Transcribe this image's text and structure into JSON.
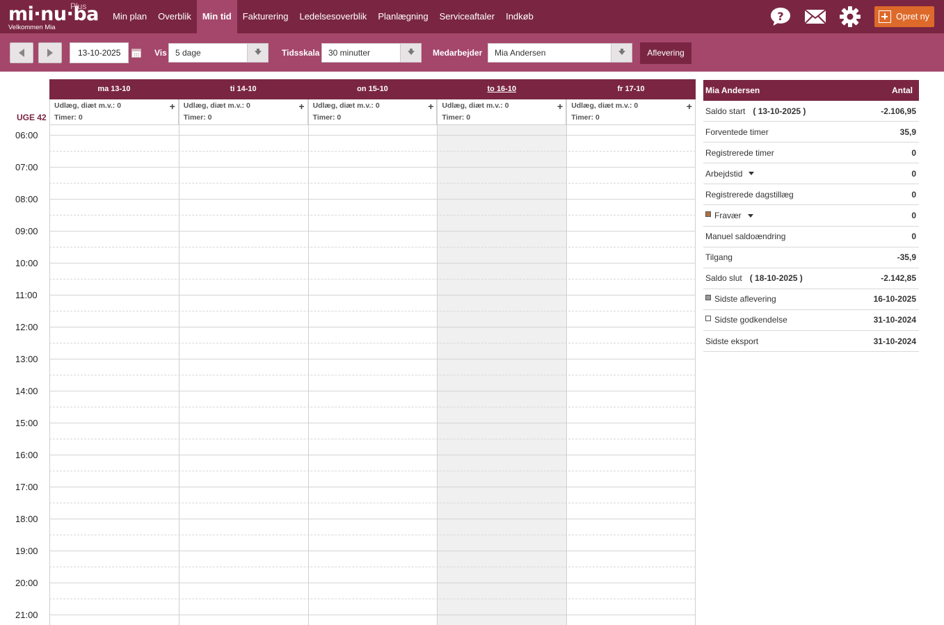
{
  "brand": {
    "logo_text": "mi·nu·ba",
    "plus": "Plus",
    "welcome": "Velkommen  Mia"
  },
  "nav": {
    "items": [
      {
        "label": "Min plan",
        "active": false
      },
      {
        "label": "Overblik",
        "active": false
      },
      {
        "label": "Min tid",
        "active": true
      },
      {
        "label": "Fakturering",
        "active": false
      },
      {
        "label": "Ledelsesoverblik",
        "active": false
      },
      {
        "label": "Planlægning",
        "active": false
      },
      {
        "label": "Serviceaftaler",
        "active": false
      },
      {
        "label": "Indkøb",
        "active": false
      }
    ],
    "icons": [
      "help-icon",
      "mail-icon",
      "gear-icon"
    ],
    "create_label": "Opret ny"
  },
  "toolbar": {
    "date": "13-10-2025",
    "vis_label": "Vis",
    "vis_value": "5 dage",
    "scale_label": "Tidsskala",
    "scale_value": "30 minutter",
    "employee_label": "Medarbejder",
    "employee_value": "Mia Andersen",
    "submit_label": "Aflevering"
  },
  "calendar": {
    "week": "UGE 42",
    "days": [
      {
        "label": "ma 13-10",
        "expenses": "Udlæg, diæt m.v.: 0",
        "hours": "Timer: 0",
        "today": false
      },
      {
        "label": "ti 14-10",
        "expenses": "Udlæg, diæt m.v.: 0",
        "hours": "Timer: 0",
        "today": false
      },
      {
        "label": "on 15-10",
        "expenses": "Udlæg, diæt m.v.: 0",
        "hours": "Timer: 0",
        "today": false
      },
      {
        "label": "to 16-10",
        "expenses": "Udlæg, diæt m.v.: 0",
        "hours": "Timer: 0",
        "today": true
      },
      {
        "label": "fr 17-10",
        "expenses": "Udlæg, diæt m.v.: 0",
        "hours": "Timer: 0",
        "today": false
      }
    ],
    "hours": [
      "06:00",
      "07:00",
      "08:00",
      "09:00",
      "10:00",
      "11:00",
      "12:00",
      "13:00",
      "14:00",
      "15:00",
      "16:00",
      "17:00",
      "18:00",
      "19:00",
      "20:00",
      "21:00"
    ]
  },
  "summary": {
    "header_name": "Mia Andersen",
    "header_value": "Antal",
    "rows": [
      {
        "label": "Saldo start",
        "paren": "( 13-10-2025 )",
        "value": "-2.106,95"
      },
      {
        "label": "Forventede timer",
        "value": "35,9"
      },
      {
        "label": "Registrerede timer",
        "value": "0"
      },
      {
        "label": "Arbejdstid",
        "dropdown": true,
        "value": "0"
      },
      {
        "label": "Registrerede dagstillæg",
        "value": "0"
      },
      {
        "label": "Fravær",
        "dropdown": true,
        "swatch": "#b07040",
        "value": "0"
      },
      {
        "label": "Manuel saldoændring",
        "value": "0"
      },
      {
        "label": "Tilgang",
        "value": "-35,9"
      },
      {
        "label": "Saldo slut",
        "paren": "( 18-10-2025 )",
        "value": "-2.142,85"
      },
      {
        "label": "Sidste aflevering",
        "swatch": "#9a9a9a",
        "value": "16-10-2025"
      },
      {
        "label": "Sidste godkendelse",
        "swatch": "#ffffff",
        "value": "31-10-2024"
      },
      {
        "label": "Sidste eksport",
        "value": "31-10-2024"
      }
    ]
  },
  "colors": {
    "primary": "#7a2642",
    "toolbar": "#a4476a",
    "accent": "#dd6a2a"
  }
}
